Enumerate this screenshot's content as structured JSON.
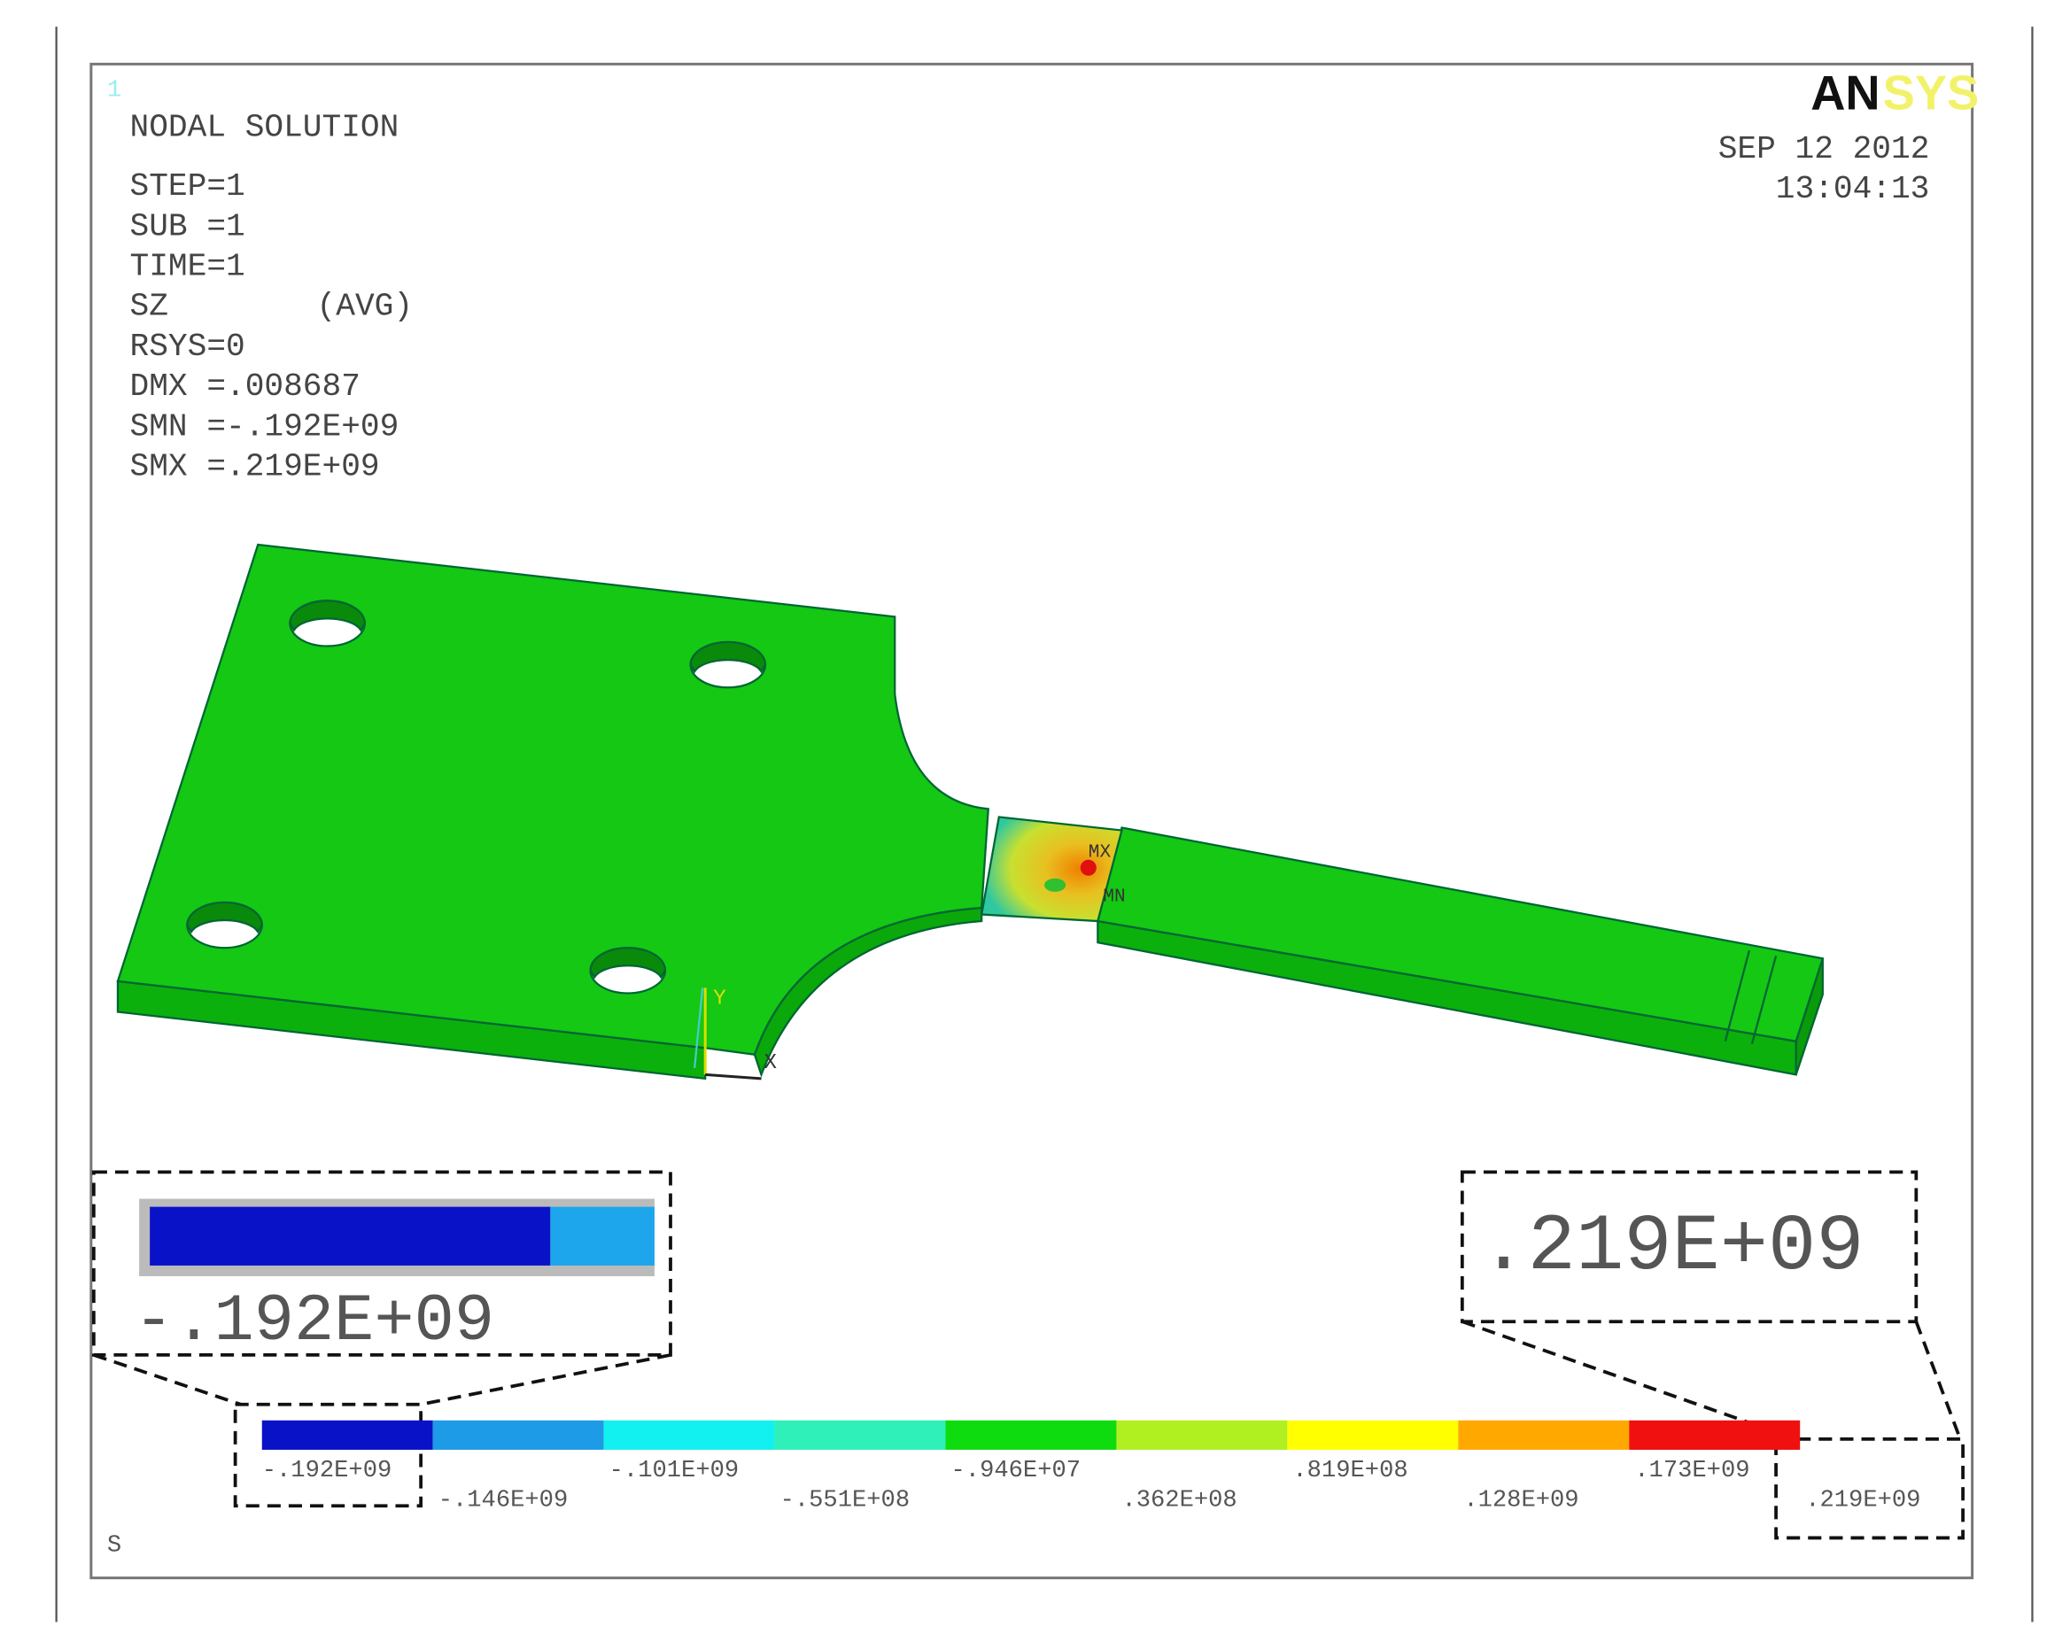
{
  "plot_number": "1",
  "header": {
    "title": "NODAL SOLUTION",
    "lines": [
      "STEP=1",
      "SUB =1",
      "TIME=1",
      "SZ",
      "RSYS=0",
      "DMX =.008687",
      "SMN =-.192E+09",
      "SMX =.219E+09"
    ],
    "avg": "(AVG)"
  },
  "logo": {
    "text_dark": "AN",
    "text_light": "SYS",
    "colors": {
      "dark": "#111111",
      "light": "#f2f26a"
    }
  },
  "datetime": {
    "date": "SEP 12 2012",
    "time": "13:04:13"
  },
  "model": {
    "max_label": "MX",
    "min_label": "MN",
    "axis_y": "Y",
    "axis_x": "X",
    "body_color": "#0fc40f"
  },
  "callouts": {
    "min_value": "-.192E+09",
    "max_value": ".219E+09"
  },
  "legend": {
    "quantity": "S",
    "colors": [
      "#0a12c8",
      "#1d9be6",
      "#12f0f0",
      "#2ef0b8",
      "#0fdc0f",
      "#b0f020",
      "#ffff00",
      "#ffa800",
      "#f01010"
    ],
    "labels": [
      "-.192E+09",
      "-.146E+09",
      "-.101E+09",
      "-.551E+08",
      "-.946E+07",
      ".362E+08",
      ".819E+08",
      ".128E+09",
      ".173E+09",
      ".219E+09"
    ]
  }
}
